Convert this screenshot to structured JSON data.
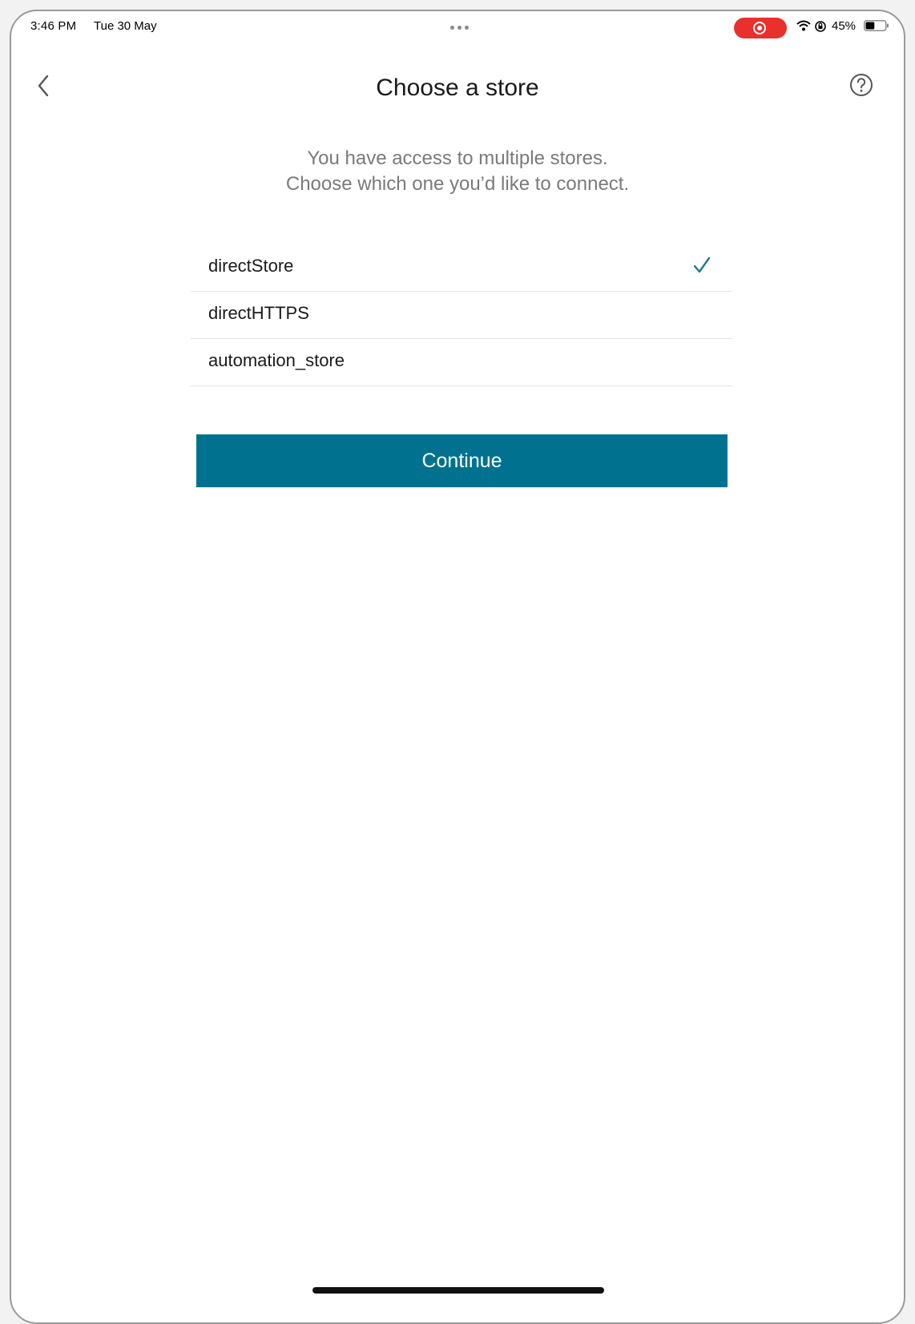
{
  "status_bar": {
    "time": "3:46 PM",
    "date": "Tue 30 May",
    "battery_percent": "45%",
    "battery_level": 0.45,
    "record_color": "#e8302c",
    "icons": [
      "wifi-icon",
      "screen-rotation-lock-icon",
      "battery-icon"
    ]
  },
  "header": {
    "title": "Choose a store",
    "back_icon": "chevron-left-icon",
    "help_icon": "question-circle-icon"
  },
  "intro": {
    "line1": "You have access to multiple stores.",
    "line2": "Choose which one you’d like to connect."
  },
  "stores": {
    "items": [
      {
        "label": "directStore",
        "selected": true
      },
      {
        "label": "directHTTPS",
        "selected": false
      },
      {
        "label": "automation_store",
        "selected": false
      }
    ]
  },
  "actions": {
    "continue_label": "Continue"
  },
  "colors": {
    "accent": "#00728f",
    "check": "#1b7a96"
  }
}
